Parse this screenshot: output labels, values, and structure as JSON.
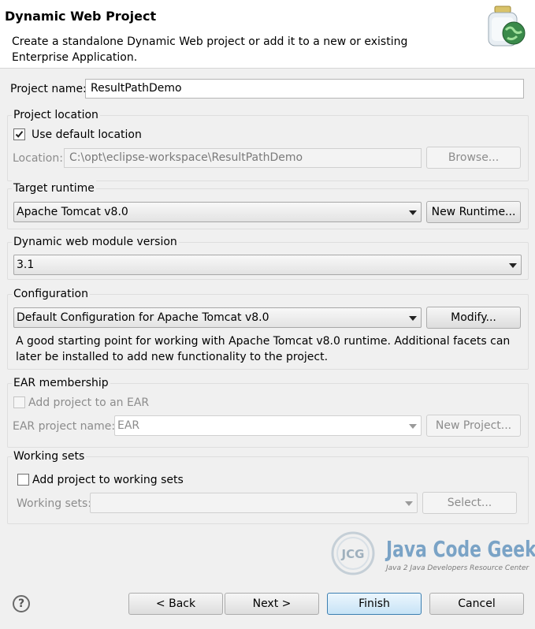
{
  "header": {
    "title": "Dynamic Web Project",
    "subtitle": "Create a standalone Dynamic Web project or add it to a new or existing Enterprise Application.",
    "icon": "web-project-jar-globe-icon"
  },
  "project_name": {
    "label": "Project name:",
    "value": "ResultPathDemo"
  },
  "project_location": {
    "title": "Project location",
    "use_default": {
      "label": "Use default location",
      "checked": true
    },
    "location_label": "Location:",
    "location_value": "C:\\opt\\eclipse-workspace\\ResultPathDemo",
    "browse_label": "Browse..."
  },
  "target_runtime": {
    "title": "Target runtime",
    "value": "Apache Tomcat v8.0",
    "new_runtime_label": "New Runtime..."
  },
  "module_version": {
    "title": "Dynamic web module version",
    "value": "3.1"
  },
  "configuration": {
    "title": "Configuration",
    "value": "Default Configuration for Apache Tomcat v8.0",
    "modify_label": "Modify...",
    "description": "A good starting point for working with Apache Tomcat v8.0 runtime. Additional facets can later be installed to add new functionality to the project."
  },
  "ear_membership": {
    "title": "EAR membership",
    "add_to_ear": {
      "label": "Add project to an EAR",
      "checked": false
    },
    "ear_name_label": "EAR project name:",
    "ear_name_value": "EAR",
    "new_project_label": "New Project..."
  },
  "working_sets": {
    "title": "Working sets",
    "add_to_sets": {
      "label": "Add project to working sets",
      "checked": false
    },
    "sets_label": "Working sets:",
    "sets_value": "",
    "select_label": "Select..."
  },
  "watermark": {
    "badge": "JCG",
    "name": "Java Code Geeks",
    "tagline": "Java 2 Java Developers Resource Center"
  },
  "footer": {
    "help_icon": "help-question-icon",
    "help_glyph": "?",
    "back_label": "< Back",
    "next_label": "Next >",
    "finish_label": "Finish",
    "cancel_label": "Cancel"
  },
  "colors": {
    "background": "#f0f0f0",
    "header": "#ffffff",
    "primary_button_border": "#3c7fb1",
    "disabled_text": "#8c8c8c"
  }
}
